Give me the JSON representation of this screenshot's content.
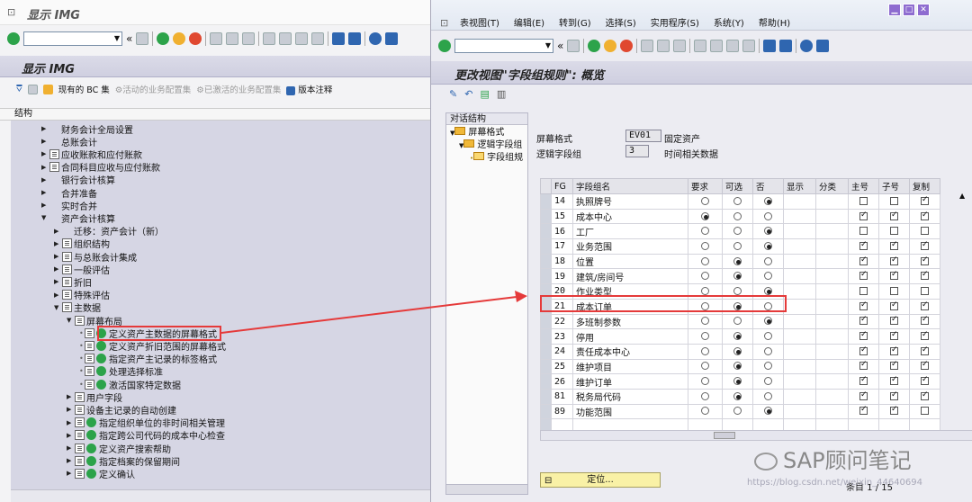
{
  "left_window": {
    "title": "显示 IMG",
    "header_title": "显示 IMG",
    "app_toolbar": {
      "bc_set": "现有的 BC 集",
      "active_bc": "活动的业务配置集",
      "activated_bc": "已激活的业务配置集",
      "release_notes": "版本注释"
    },
    "structure_label": "结构",
    "tree": [
      {
        "text": "财务会计全局设置",
        "level": 1
      },
      {
        "text": "总账会计",
        "level": 1
      },
      {
        "text": "应收账款和应付账款",
        "level": 1,
        "doc": true
      },
      {
        "text": "合同科目应收与应付账款",
        "level": 1,
        "doc": true
      },
      {
        "text": "银行会计核算",
        "level": 1
      },
      {
        "text": "合并准备",
        "level": 1
      },
      {
        "text": "实时合并",
        "level": 1
      },
      {
        "text": "资产会计核算",
        "level": 1,
        "expanded": true
      },
      {
        "text": "迁移：资产会计（新）",
        "level": 2
      },
      {
        "text": "组织结构",
        "level": 2,
        "doc": true
      },
      {
        "text": "与总账会计集成",
        "level": 2,
        "doc": true
      },
      {
        "text": "一般评估",
        "level": 2,
        "doc": true
      },
      {
        "text": "折旧",
        "level": 2,
        "doc": true
      },
      {
        "text": "特殊评估",
        "level": 2,
        "doc": true
      },
      {
        "text": "主数据",
        "level": 2,
        "doc": true,
        "expanded": true
      },
      {
        "text": "屏幕布局",
        "level": 3,
        "doc": true,
        "expanded": true
      },
      {
        "text": "定义资产主数据的屏幕格式",
        "level": 4,
        "exec": true
      },
      {
        "text": "定义资产折旧范围的屏幕格式",
        "level": 4,
        "exec": true
      },
      {
        "text": "指定资产主记录的标签格式",
        "level": 4,
        "exec": true
      },
      {
        "text": "处理选择标准",
        "level": 4,
        "exec": true
      },
      {
        "text": "激活国家特定数据",
        "level": 4,
        "exec": true
      },
      {
        "text": "用户字段",
        "level": 3,
        "doc": true
      },
      {
        "text": "设备主记录的自动创建",
        "level": 3,
        "doc": true
      },
      {
        "text": "指定组织单位的非时间相关管理",
        "level": 3,
        "exec": true
      },
      {
        "text": "指定跨公司代码的成本中心检查",
        "level": 3,
        "exec": true
      },
      {
        "text": "定义资产搜索帮助",
        "level": 3,
        "exec": true
      },
      {
        "text": "指定档案的保留期间",
        "level": 3,
        "exec": true
      },
      {
        "text": "定义确认",
        "level": 3,
        "exec": true
      }
    ]
  },
  "right_window": {
    "menu": [
      "表视图(T)",
      "编辑(E)",
      "转到(G)",
      "选择(S)",
      "实用程序(S)",
      "系统(Y)",
      "帮助(H)"
    ],
    "view_title": "更改视图\"字段组规则\": 概览",
    "dialog": {
      "header": "对话结构",
      "items": [
        "屏幕格式",
        "逻辑字段组",
        "字段组规"
      ]
    },
    "screen_layout_label": "屏幕格式",
    "screen_layout_value": "EV01",
    "screen_layout_desc": "固定资产",
    "logical_group_label": "逻辑字段组",
    "logical_group_value": "3",
    "logical_group_desc": "时间相关数据",
    "columns": [
      "FG",
      "字段组名",
      "要求",
      "可选",
      "否",
      "显示",
      "分类",
      "主号",
      "子号",
      "复制"
    ],
    "rows": [
      {
        "fg": "14",
        "name": "执照牌号",
        "radio": 2,
        "main": false,
        "sub": false,
        "copy": true
      },
      {
        "fg": "15",
        "name": "成本中心",
        "radio": 0,
        "main": true,
        "sub": true,
        "copy": true
      },
      {
        "fg": "16",
        "name": "工厂",
        "radio": 2,
        "main": false,
        "sub": false,
        "copy": false
      },
      {
        "fg": "17",
        "name": "业务范围",
        "radio": 2,
        "main": true,
        "sub": true,
        "copy": true
      },
      {
        "fg": "18",
        "name": "位置",
        "radio": 1,
        "main": true,
        "sub": true,
        "copy": true
      },
      {
        "fg": "19",
        "name": "建筑/房间号",
        "radio": 1,
        "main": true,
        "sub": true,
        "copy": true
      },
      {
        "fg": "20",
        "name": "作业类型",
        "radio": 2,
        "main": false,
        "sub": false,
        "copy": false
      },
      {
        "fg": "21",
        "name": "成本订单",
        "radio": 1,
        "main": true,
        "sub": true,
        "copy": true
      },
      {
        "fg": "22",
        "name": "多班制参数",
        "radio": 2,
        "main": true,
        "sub": true,
        "copy": true
      },
      {
        "fg": "23",
        "name": "停用",
        "radio": 1,
        "main": true,
        "sub": true,
        "copy": true
      },
      {
        "fg": "24",
        "name": "责任成本中心",
        "radio": 1,
        "main": true,
        "sub": true,
        "copy": true
      },
      {
        "fg": "25",
        "name": "维护项目",
        "radio": 1,
        "main": true,
        "sub": true,
        "copy": true
      },
      {
        "fg": "26",
        "name": "维护订单",
        "radio": 1,
        "main": true,
        "sub": true,
        "copy": true
      },
      {
        "fg": "81",
        "name": "税务局代码",
        "radio": 1,
        "main": true,
        "sub": true,
        "copy": true
      },
      {
        "fg": "89",
        "name": "功能范围",
        "radio": 2,
        "main": true,
        "sub": true,
        "copy": false
      }
    ],
    "locate_button": "定位...",
    "entry_count": "条目 1 / 15"
  },
  "watermark": "SAP顾问笔记",
  "watermark_url": "https://blog.csdn.net/weixin_44640694",
  "colors": {
    "highlight": "#e53a3a",
    "header_bg": "#d6d6e4",
    "accent": "#8e6cd0"
  }
}
